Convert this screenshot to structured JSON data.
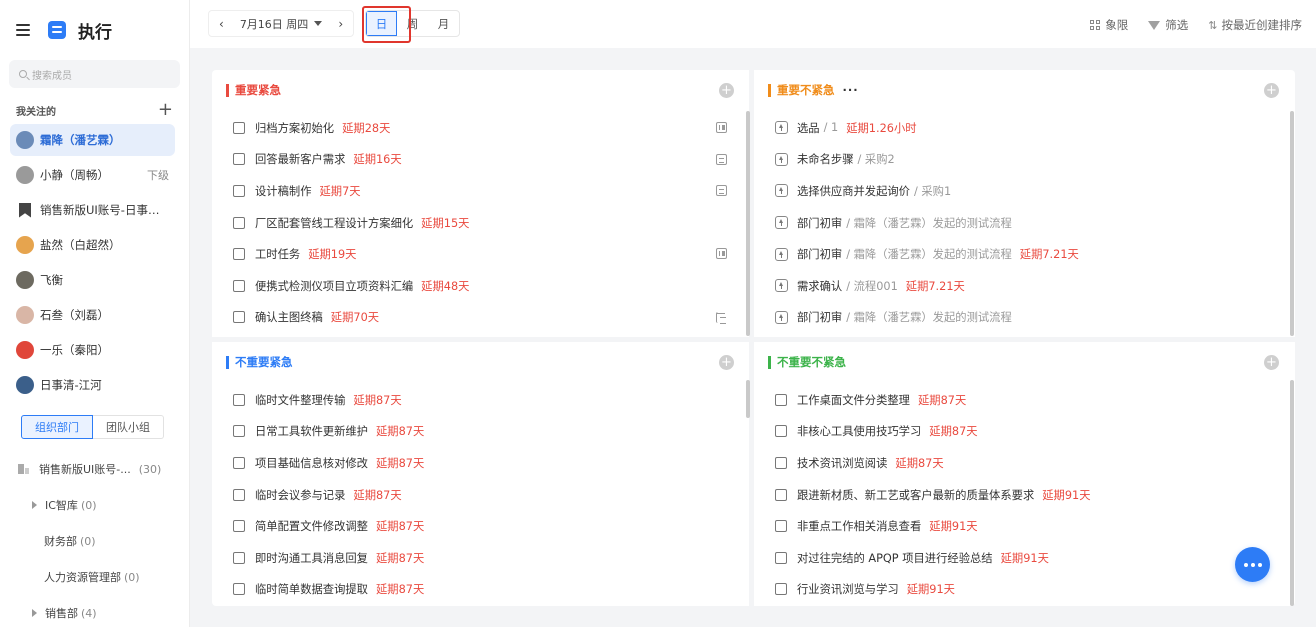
{
  "app": {
    "title": "执行"
  },
  "sidebar": {
    "search_placeholder": "搜索成员",
    "following_label": "我关注的",
    "people": [
      {
        "name": "霜降（潘艺霖）",
        "tag": "",
        "active": true,
        "avatar": "#6b8bb8"
      },
      {
        "name": "小静（周畅）",
        "tag": "下级",
        "active": false,
        "avatar": "#9a9a9a"
      },
      {
        "name": "销售新版UI账号-日事清...",
        "tag": "",
        "active": false,
        "avatar": "bookmark"
      },
      {
        "name": "盐然（白超然）",
        "tag": "",
        "active": false,
        "avatar": "#e6a44e"
      },
      {
        "name": "飞衡",
        "tag": "",
        "active": false,
        "avatar": "#6d6a60"
      },
      {
        "name": "石叁（刘磊）",
        "tag": "",
        "active": false,
        "avatar": "#d9b6a6"
      },
      {
        "name": "一乐（秦阳）",
        "tag": "",
        "active": false,
        "avatar": "#e0463a"
      },
      {
        "name": "日事清-江河",
        "tag": "",
        "active": false,
        "avatar": "#3b5f8a"
      }
    ],
    "tabs": {
      "org": "组织部门",
      "team": "团队小组"
    },
    "departments": [
      {
        "name": "销售新版UI账号-...",
        "count": "(30)"
      },
      {
        "name": "IC智库",
        "count": "(0)"
      },
      {
        "name": "财务部",
        "count": "(0)"
      },
      {
        "name": "人力资源管理部",
        "count": "(0)"
      },
      {
        "name": "销售部",
        "count": "(4)"
      }
    ]
  },
  "topbar": {
    "prev": "‹",
    "next": "›",
    "date": "7月16日 周四",
    "views": {
      "day": "日",
      "week": "周",
      "month": "月"
    },
    "active_view": "日",
    "tools": {
      "quadrant": "象限",
      "filter": "筛选",
      "sort": "按最近创建排序"
    }
  },
  "quadrants": {
    "q1": {
      "title": "重要紧急",
      "color": "#e94a3f",
      "tasks": [
        {
          "name": "归档方案初始化",
          "late": "延期28天",
          "icon": "board"
        },
        {
          "name": "回答最新客户需求",
          "late": "延期16天",
          "icon": "doc"
        },
        {
          "name": "设计稿制作",
          "late": "延期7天",
          "icon": "doc"
        },
        {
          "name": "厂区配套管线工程设计方案细化",
          "late": "延期15天",
          "icon": ""
        },
        {
          "name": "工时任务",
          "late": "延期19天",
          "icon": "board"
        },
        {
          "name": "便携式检测仪项目立项资料汇编",
          "late": "延期48天",
          "icon": ""
        },
        {
          "name": "确认主图终稿",
          "late": "延期70天",
          "icon": "tree"
        }
      ]
    },
    "q2": {
      "title": "重要不紧急",
      "more": "···",
      "color": "#f08c1a",
      "tasks": [
        {
          "name": "选品",
          "sub": "/ 1",
          "late": "延期1.26小时"
        },
        {
          "name": "未命名步骤",
          "sub": "/ 采购2",
          "late": ""
        },
        {
          "name": "选择供应商并发起询价",
          "sub": "/ 采购1",
          "late": ""
        },
        {
          "name": "部门初审",
          "sub": "/ 霜降（潘艺霖）发起的测试流程",
          "late": ""
        },
        {
          "name": "部门初审",
          "sub": "/ 霜降（潘艺霖）发起的测试流程",
          "late": "延期7.21天"
        },
        {
          "name": "需求确认",
          "sub": "/ 流程001",
          "late": "延期7.21天"
        },
        {
          "name": "部门初审",
          "sub": "/ 霜降（潘艺霖）发起的测试流程",
          "late": ""
        }
      ]
    },
    "q3": {
      "title": "不重要紧急",
      "color": "#2d7cf6",
      "tasks": [
        {
          "name": "临时文件整理传输",
          "late": "延期87天"
        },
        {
          "name": "日常工具软件更新维护",
          "late": "延期87天"
        },
        {
          "name": "项目基础信息核对修改",
          "late": "延期87天"
        },
        {
          "name": "临时会议参与记录",
          "late": "延期87天"
        },
        {
          "name": "简单配置文件修改调整",
          "late": "延期87天"
        },
        {
          "name": "即时沟通工具消息回复",
          "late": "延期87天"
        },
        {
          "name": "临时简单数据查询提取",
          "late": "延期87天"
        }
      ]
    },
    "q4": {
      "title": "不重要不紧急",
      "color": "#3cb34a",
      "tasks": [
        {
          "name": "工作桌面文件分类整理",
          "late": "延期87天"
        },
        {
          "name": "非核心工具使用技巧学习",
          "late": "延期87天"
        },
        {
          "name": "技术资讯浏览阅读",
          "late": "延期87天"
        },
        {
          "name": "跟进新材质、新工艺或客户最新的质量体系要求",
          "late": "延期91天"
        },
        {
          "name": "非重点工作相关消息查看",
          "late": "延期91天"
        },
        {
          "name": "对过往完结的 APQP 项目进行经验总结",
          "late": "延期91天"
        },
        {
          "name": "行业资讯浏览与学习",
          "late": "延期91天"
        }
      ]
    }
  }
}
